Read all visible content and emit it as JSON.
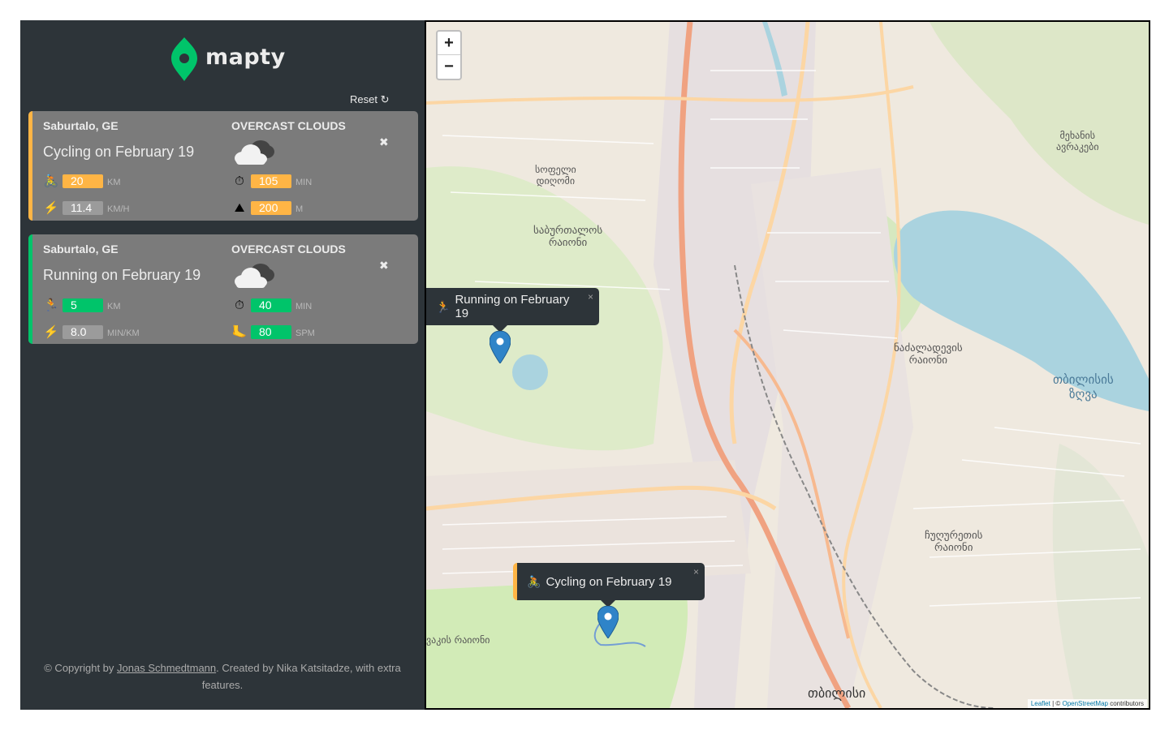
{
  "app": {
    "logo_text": "mapty"
  },
  "sidebar": {
    "reset_label": "Reset ↻",
    "workouts": [
      {
        "type": "cycling",
        "location": "Saburtalo, GE",
        "weather": "OVERCAST CLOUDS",
        "title": "Cycling on February 19",
        "close": "✖",
        "stat1": {
          "icon": "🚴",
          "value": "20",
          "unit": "KM"
        },
        "stat2": {
          "icon": "⏱",
          "value": "105",
          "unit": "MIN"
        },
        "stat3": {
          "icon": "⚡",
          "value": "11.4",
          "unit": "KM/H"
        },
        "stat4": {
          "icon": "⛰",
          "value": "200",
          "unit": "M"
        }
      },
      {
        "type": "running",
        "location": "Saburtalo, GE",
        "weather": "OVERCAST CLOUDS",
        "title": "Running on February 19",
        "close": "✖",
        "stat1": {
          "icon": "🏃",
          "value": "5",
          "unit": "KM"
        },
        "stat2": {
          "icon": "⏱",
          "value": "40",
          "unit": "MIN"
        },
        "stat3": {
          "icon": "⚡",
          "value": "8.0",
          "unit": "MIN/KM"
        },
        "stat4": {
          "icon": "🦶",
          "value": "80",
          "unit": "SPM"
        }
      }
    ],
    "copyright": {
      "prefix": "© Copyright by ",
      "author": "Jonas Schmedtmann",
      "suffix": ". Created by Nika Katsitadze, with extra features."
    }
  },
  "map": {
    "zoom_in": "+",
    "zoom_out": "−",
    "popups": {
      "running": {
        "emoji": "🏃",
        "text": "Running on February 19",
        "close": "×"
      },
      "cycling": {
        "emoji": "🚴",
        "text": "Cycling on February 19",
        "close": "×"
      }
    },
    "attribution": {
      "leaflet": "Leaflet",
      "sep": " | © ",
      "osm": "OpenStreetMap",
      "suffix": " contributors"
    },
    "labels": {
      "l1": "სოფელი\nდიღომი",
      "l2": "საბურთალოს\nრაიონი",
      "l3": "ნაძალადევის\nრაიონი",
      "l4": "თბილისის\nზღვა",
      "l5": "ჩუღურეთის\nრაიონი",
      "l6": "თბილისი",
      "l7": "მეხანის\nავრაკები",
      "l8": "ვაკის რაიონი"
    },
    "colors": {
      "park": "#cdebb0",
      "water": "#aad3df",
      "road_major": "#f0a281",
      "road_minor": "#fcd6a4",
      "land": "#efe9df"
    }
  }
}
